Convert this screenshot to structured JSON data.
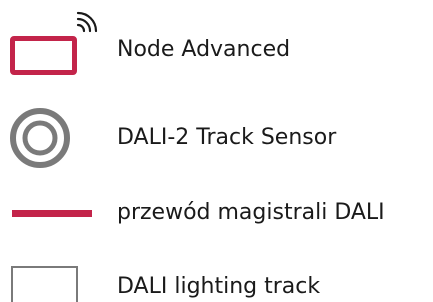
{
  "legend": {
    "items": [
      {
        "label": "Node Advanced",
        "symbol": "node-rect-with-signal-icon",
        "color": "#c3244a"
      },
      {
        "label": "DALI-2 Track Sensor",
        "symbol": "sensor-rings-icon",
        "color": "#7a7a7a"
      },
      {
        "label": "przewód magistrali DALI",
        "symbol": "bus-line-icon",
        "color": "#c3244a"
      },
      {
        "label": "DALI lighting track",
        "symbol": "track-rect-icon",
        "color": "#7a7a7a"
      }
    ]
  }
}
